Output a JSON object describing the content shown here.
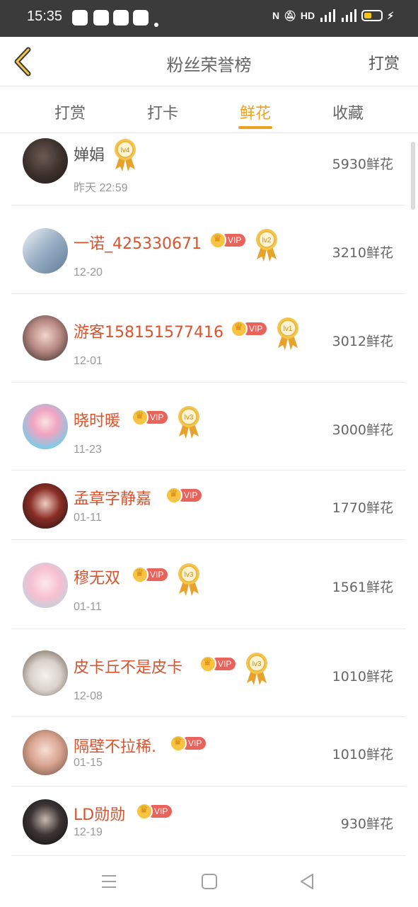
{
  "status_bar": {
    "time": "15:35",
    "network": "4G 4G"
  },
  "header": {
    "title": "粉丝荣誉榜",
    "action": "打赏"
  },
  "tabs": [
    {
      "label": "打赏",
      "active": false
    },
    {
      "label": "打卡",
      "active": false
    },
    {
      "label": "鲜花",
      "active": true
    },
    {
      "label": "收藏",
      "active": false
    }
  ],
  "vip_label": "VIP",
  "rows": [
    {
      "name": "婵娟",
      "date": "昨天 22:59",
      "amount": "5930鲜花",
      "vip": false,
      "level": "lv4"
    },
    {
      "name": "一诺_425330671",
      "date": "12-20",
      "amount": "3210鲜花",
      "vip": true,
      "level": "lv2"
    },
    {
      "name": "游客158151577416",
      "date": "12-01",
      "amount": "3012鲜花",
      "vip": true,
      "level": "lv1"
    },
    {
      "name": "晓时暖",
      "date": "11-23",
      "amount": "3000鲜花",
      "vip": true,
      "level": "lv3"
    },
    {
      "name": "孟章字静嘉",
      "date": "01-11",
      "amount": "1770鲜花",
      "vip": true,
      "level": ""
    },
    {
      "name": "穆无双",
      "date": "01-11",
      "amount": "1561鲜花",
      "vip": true,
      "level": "lv3"
    },
    {
      "name": "皮卡丘不是皮卡",
      "date": "12-08",
      "amount": "1010鲜花",
      "vip": true,
      "level": "lv3"
    },
    {
      "name": "隔壁不拉稀.",
      "date": "01-15",
      "amount": "1010鲜花",
      "vip": true,
      "level": ""
    },
    {
      "name": "LD勋勋",
      "date": "12-19",
      "amount": "930鲜花",
      "vip": true,
      "level": ""
    }
  ],
  "colors": {
    "accent": "#f0a020",
    "name_red": "#d9532e",
    "vip_tag": "#e8635a",
    "status_bar": "#3b3b3b"
  }
}
